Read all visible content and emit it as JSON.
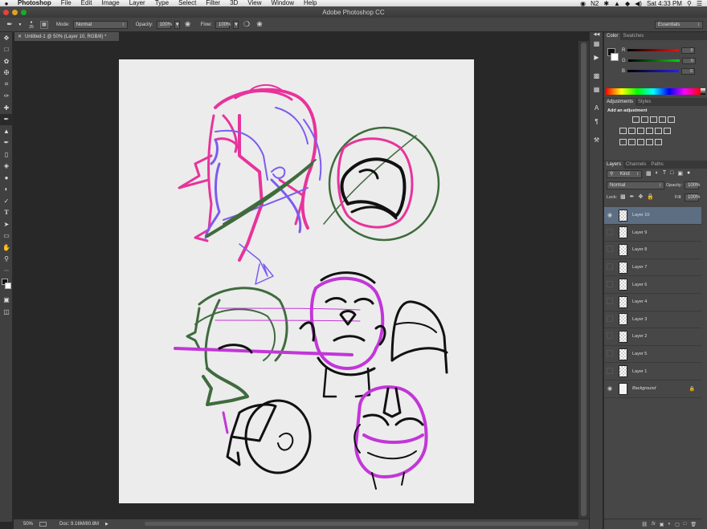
{
  "menubar": {
    "items": [
      "Photoshop",
      "File",
      "Edit",
      "Image",
      "Layer",
      "Type",
      "Select",
      "Filter",
      "3D",
      "View",
      "Window",
      "Help"
    ],
    "status_icons": [
      "◉",
      "◉",
      "N2",
      "✱",
      "◉",
      "▲",
      "◆",
      "◀)"
    ],
    "clock": "Sat 4:33 PM",
    "search_icon": "search-icon",
    "list_icon": "list-icon"
  },
  "window": {
    "title": "Adobe Photoshop CC"
  },
  "options": {
    "brush_size": "25",
    "mode_label": "Mode:",
    "mode_value": "Normal",
    "opacity_label": "Opacity:",
    "opacity_value": "100%",
    "flow_label": "Flow:",
    "flow_value": "100%",
    "workspace": "Essentials"
  },
  "document": {
    "tab_title": "Untitled-1 @ 50% (Layer 10, RGB/8) *",
    "zoom": "50%",
    "doc_size": "Doc: 9.16M/80.8M"
  },
  "color_panel": {
    "tabs": [
      "Color",
      "Swatches"
    ],
    "r_label": "R",
    "g_label": "G",
    "b_label": "B",
    "r_value": "0",
    "g_value": "0",
    "b_value": "0",
    "colors": {
      "r": "#e11",
      "g": "#1c1",
      "b": "#22e"
    }
  },
  "adjustments_panel": {
    "tabs": [
      "Adjustments",
      "Styles"
    ],
    "heading": "Add an adjustment"
  },
  "layers_panel": {
    "tabs": [
      "Layers",
      "Channels",
      "Paths"
    ],
    "kind_label": "Kind",
    "blend_mode": "Normal",
    "opacity_label": "Opacity:",
    "opacity_value": "100%",
    "lock_label": "Lock:",
    "fill_label": "Fill:",
    "fill_value": "100%",
    "layers": [
      {
        "name": "Layer 10",
        "visible": true,
        "selected": true
      },
      {
        "name": "Layer 9",
        "visible": false,
        "selected": false
      },
      {
        "name": "Layer 8",
        "visible": false,
        "selected": false
      },
      {
        "name": "Layer 7",
        "visible": false,
        "selected": false
      },
      {
        "name": "Layer 6",
        "visible": false,
        "selected": false
      },
      {
        "name": "Layer 4",
        "visible": false,
        "selected": false
      },
      {
        "name": "Layer 3",
        "visible": false,
        "selected": false
      },
      {
        "name": "Layer 2",
        "visible": false,
        "selected": false
      },
      {
        "name": "Layer 5",
        "visible": false,
        "selected": false
      },
      {
        "name": "Layer 1",
        "visible": false,
        "selected": false
      },
      {
        "name": "Background",
        "visible": true,
        "selected": false
      }
    ],
    "footer_icons": [
      "link-icon",
      "fx-icon",
      "mask-icon",
      "adjustment-icon",
      "group-icon",
      "new-layer-icon",
      "trash-icon"
    ]
  },
  "palette": {
    "pink": "#e8339b",
    "purple": "#7b5cf0",
    "magenta": "#c236d8",
    "green": "#3f6b3d",
    "black": "#111111"
  }
}
